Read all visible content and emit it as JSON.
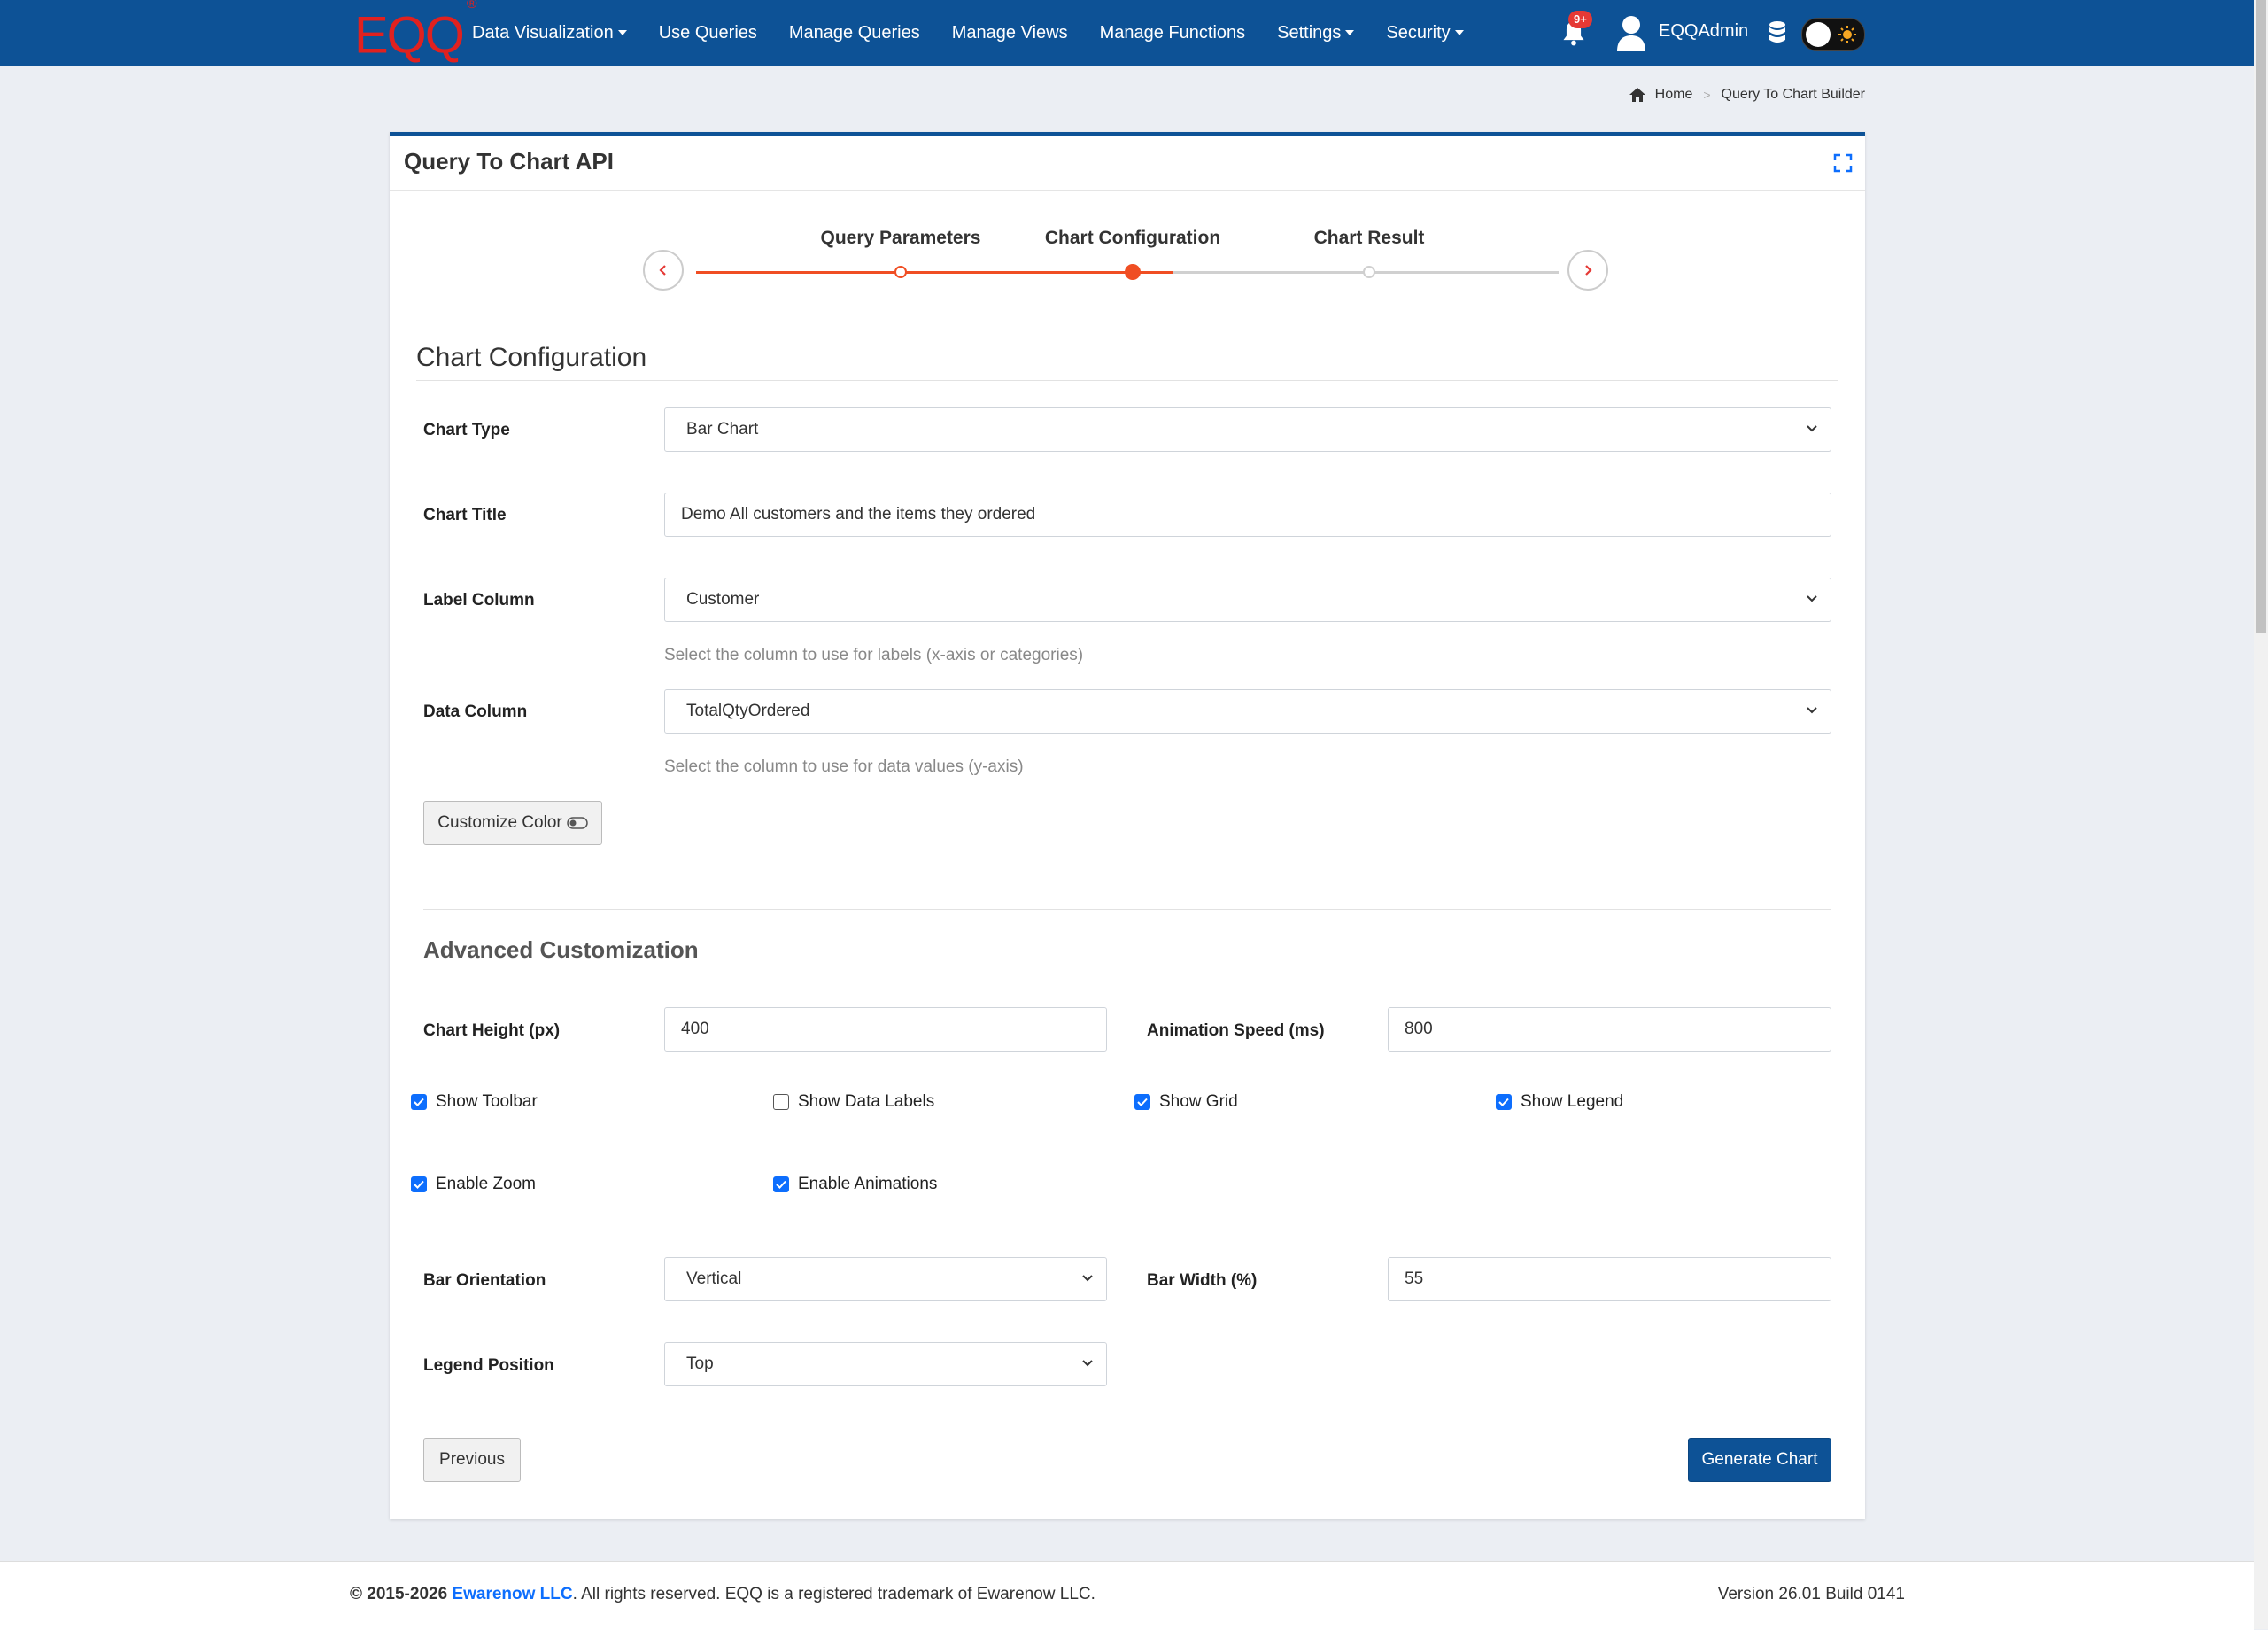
{
  "navbar": {
    "logo": "EQQ",
    "logo_mark": "®",
    "items": [
      {
        "label": "Data Visualization",
        "dropdown": true
      },
      {
        "label": "Use Queries",
        "dropdown": false
      },
      {
        "label": "Manage Queries",
        "dropdown": false
      },
      {
        "label": "Manage Views",
        "dropdown": false
      },
      {
        "label": "Manage Functions",
        "dropdown": false
      },
      {
        "label": "Settings",
        "dropdown": true
      },
      {
        "label": "Security",
        "dropdown": true
      }
    ],
    "notification_badge": "9+",
    "username": "EQQAdmin",
    "icons": [
      "bell-icon",
      "user-icon",
      "database-icon",
      "sun-icon"
    ],
    "brand_color": "#0d5296"
  },
  "breadcrumb": {
    "home": "Home",
    "current": "Query To Chart Builder"
  },
  "card": {
    "title": "Query To Chart API",
    "stepper": {
      "steps": [
        {
          "label": "Query Parameters",
          "state": "done"
        },
        {
          "label": "Chart Configuration",
          "state": "active"
        },
        {
          "label": "Chart Result",
          "state": "pending"
        }
      ],
      "accent": "#f04e23"
    },
    "section_title": "Chart Configuration",
    "chart_type": {
      "label": "Chart Type",
      "value": "Bar Chart"
    },
    "chart_title": {
      "label": "Chart Title",
      "value": "Demo All customers and the items they ordered"
    },
    "label_column": {
      "label": "Label Column",
      "value": "Customer",
      "help": "Select the column to use for labels (x-axis or categories)"
    },
    "data_column": {
      "label": "Data Column",
      "value": "TotalQtyOrdered",
      "help": "Select the column to use for data values (y-axis)"
    },
    "customize_color": "Customize Color",
    "advanced": {
      "title": "Advanced Customization",
      "chart_height": {
        "label": "Chart Height (px)",
        "value": "400"
      },
      "animation_speed": {
        "label": "Animation Speed (ms)",
        "value": "800"
      },
      "checks": [
        {
          "label": "Show Toolbar",
          "checked": true
        },
        {
          "label": "Show Data Labels",
          "checked": false
        },
        {
          "label": "Show Grid",
          "checked": true
        },
        {
          "label": "Show Legend",
          "checked": true
        },
        {
          "label": "Enable Zoom",
          "checked": true
        },
        {
          "label": "Enable Animations",
          "checked": true
        }
      ],
      "bar_orientation": {
        "label": "Bar Orientation",
        "value": "Vertical"
      },
      "bar_width": {
        "label": "Bar Width (%)",
        "value": "55"
      },
      "legend_position": {
        "label": "Legend Position",
        "value": "Top"
      }
    },
    "previous_button": "Previous",
    "generate_button": "Generate Chart"
  },
  "footer": {
    "copyright": "© 2015-2026",
    "company": "Ewarenow LLC",
    "rights": ". All rights reserved. EQQ is a registered trademark of Ewarenow LLC.",
    "version": "Version 26.01 Build 0141"
  }
}
